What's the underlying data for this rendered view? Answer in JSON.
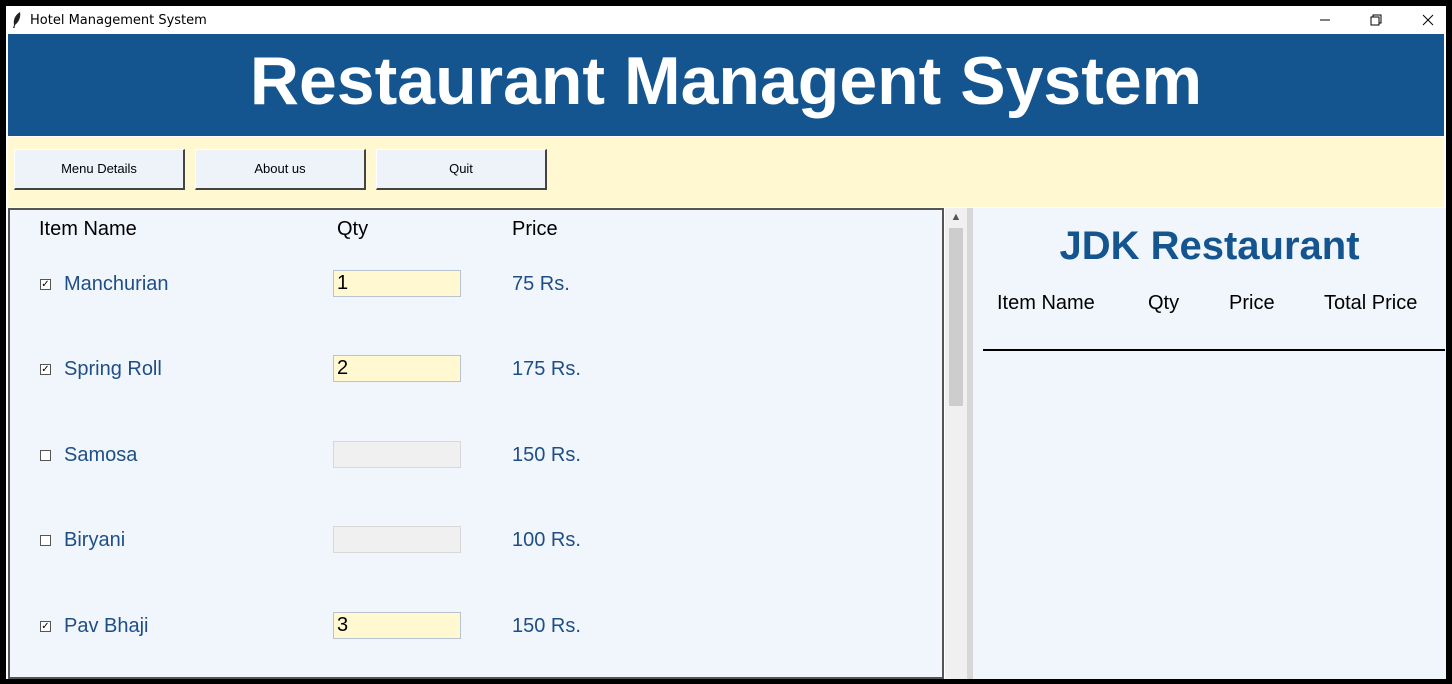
{
  "window": {
    "title": "Hotel Management System",
    "controls": [
      "minimize-icon",
      "restore-icon",
      "close-icon"
    ]
  },
  "header": {
    "title": "Restaurant Managent System"
  },
  "toolbar": {
    "menu_details": "Menu Details",
    "about_us": "About us",
    "quit": "Quit"
  },
  "menu": {
    "columns": {
      "item": "Item Name",
      "qty": "Qty",
      "price": "Price"
    },
    "items": [
      {
        "name": "Manchurian",
        "checked": true,
        "qty": "1",
        "price": "75 Rs."
      },
      {
        "name": "Spring Roll",
        "checked": true,
        "qty": "2",
        "price": "175 Rs."
      },
      {
        "name": "Samosa",
        "checked": false,
        "qty": "",
        "price": "150 Rs."
      },
      {
        "name": "Biryani",
        "checked": false,
        "qty": "",
        "price": "100 Rs."
      },
      {
        "name": "Pav Bhaji",
        "checked": true,
        "qty": "3",
        "price": "150 Rs."
      }
    ]
  },
  "bill": {
    "title": "JDK Restaurant",
    "columns": {
      "item": "Item Name",
      "qty": "Qty",
      "price": "Price",
      "total": "Total Price"
    }
  },
  "colors": {
    "header_bg": "#14548f",
    "toolbar_bg": "#fff8d0",
    "panel_bg": "#f0f6fc",
    "item_text": "#1f4e86",
    "qty_active_bg": "#fff8d0",
    "qty_disabled_bg": "#f0f0f0"
  }
}
